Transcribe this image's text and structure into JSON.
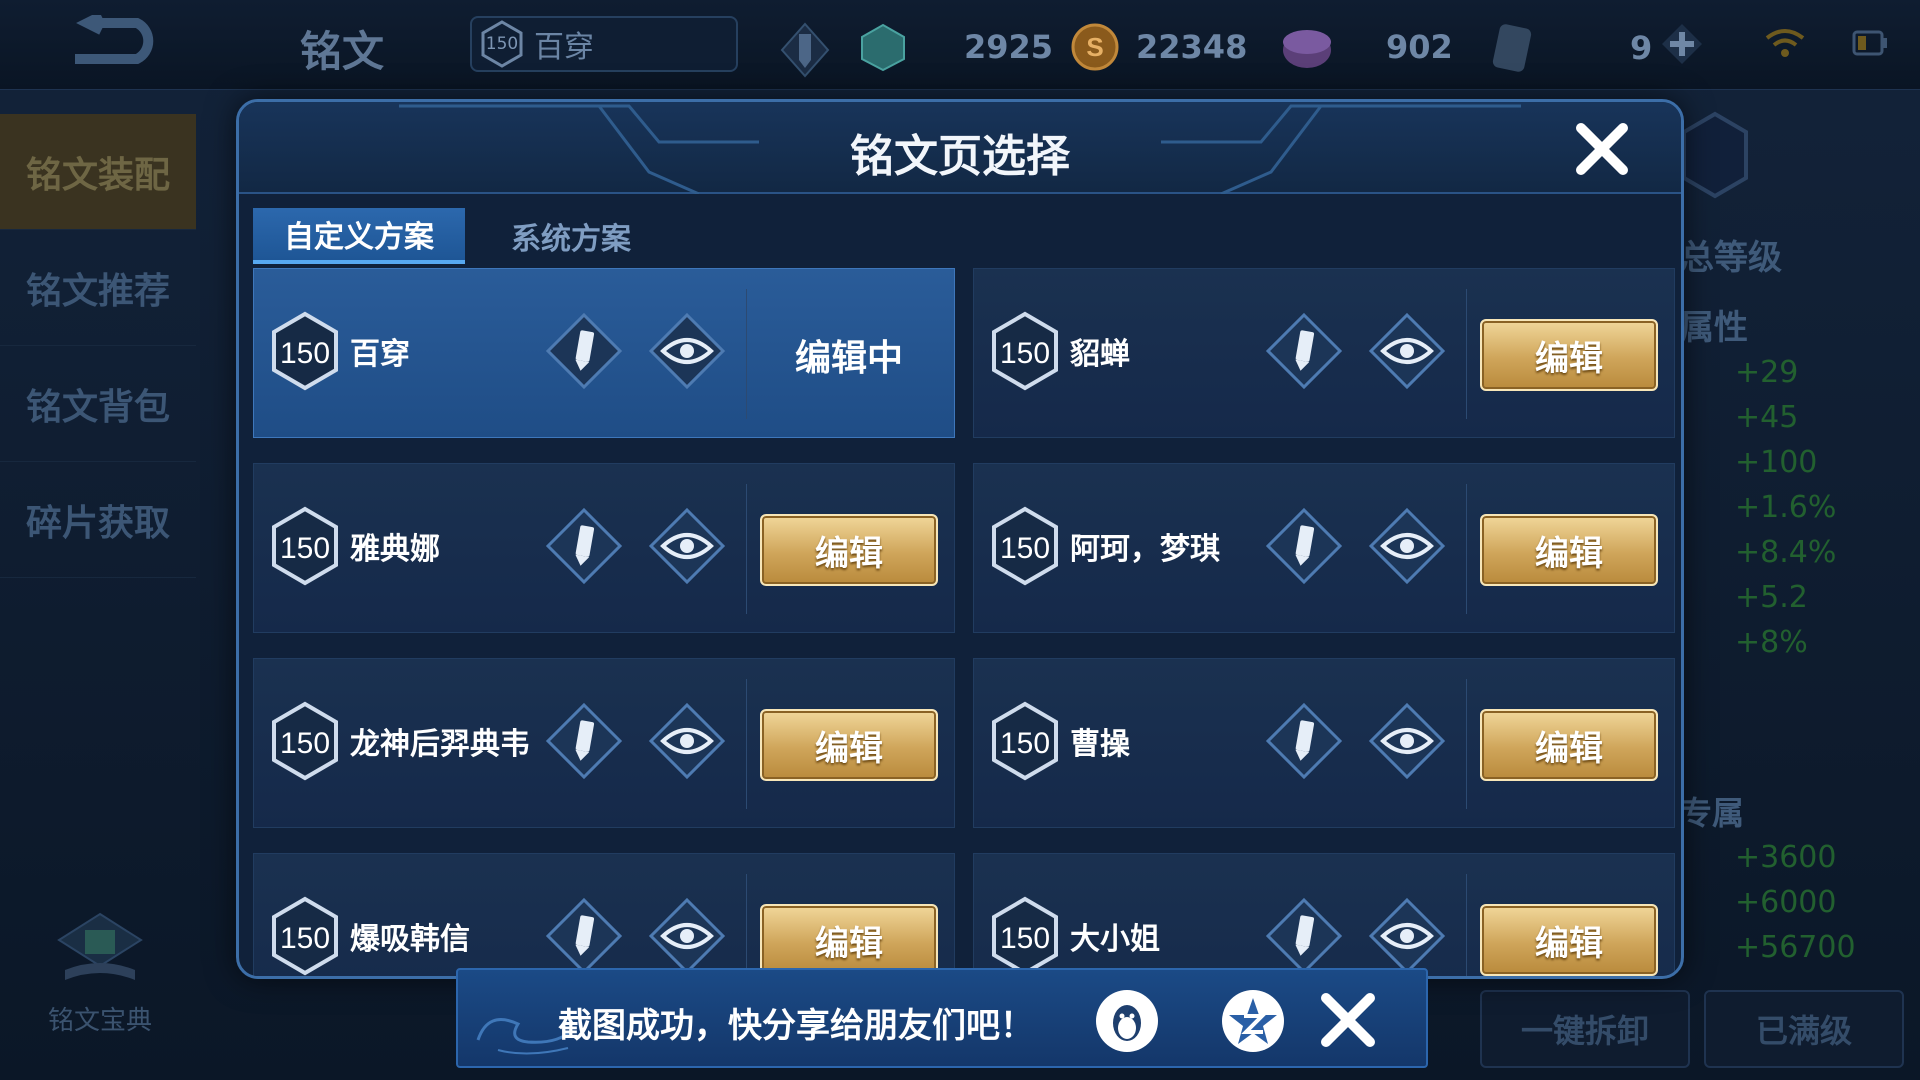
{
  "topbar": {
    "title": "铭文",
    "page_level": "150",
    "page_name": "百穿",
    "currency_1": "2925",
    "currency_2": "22348",
    "currency_3": "902",
    "currency_4": "9"
  },
  "sidebar": {
    "items": [
      {
        "label": "铭文装配"
      },
      {
        "label": "铭文推荐"
      },
      {
        "label": "铭文背包"
      },
      {
        "label": "碎片获取"
      }
    ],
    "codex_label": "铭文宝典"
  },
  "right_panel": {
    "level_label": "总等级",
    "attr_label": "属性",
    "stats": [
      "+29",
      "+45",
      "+100",
      "+1.6%",
      "+8.4%",
      "+5.2",
      "+8%"
    ],
    "exclusive_label": "专属",
    "exclusive_stats": [
      "+3600",
      "+6000",
      "+56700"
    ],
    "unload_button": "一键拆卸",
    "max_button": "已满级"
  },
  "modal": {
    "title": "铭文页选择",
    "tabs": [
      {
        "label": "自定义方案"
      },
      {
        "label": "系统方案"
      }
    ],
    "cards": [
      {
        "level": "150",
        "name": "百穿",
        "action": "编辑中"
      },
      {
        "level": "150",
        "name": "貂蝉",
        "action": "编辑"
      },
      {
        "level": "150",
        "name": "雅典娜",
        "action": "编辑"
      },
      {
        "level": "150",
        "name": "阿珂，梦琪",
        "action": "编辑"
      },
      {
        "level": "150",
        "name": "龙神后羿典韦",
        "action": "编辑"
      },
      {
        "level": "150",
        "name": "曹操",
        "action": "编辑"
      },
      {
        "level": "150",
        "name": "爆吸韩信",
        "action": "编辑"
      },
      {
        "level": "150",
        "name": "大小姐",
        "action": "编辑"
      }
    ]
  },
  "toast": {
    "text": "截图成功，快分享给朋友们吧！"
  },
  "colors": {
    "gold_button": "#cfa55a",
    "selected_card": "#2a5c99",
    "stat_green": "#22602f"
  }
}
